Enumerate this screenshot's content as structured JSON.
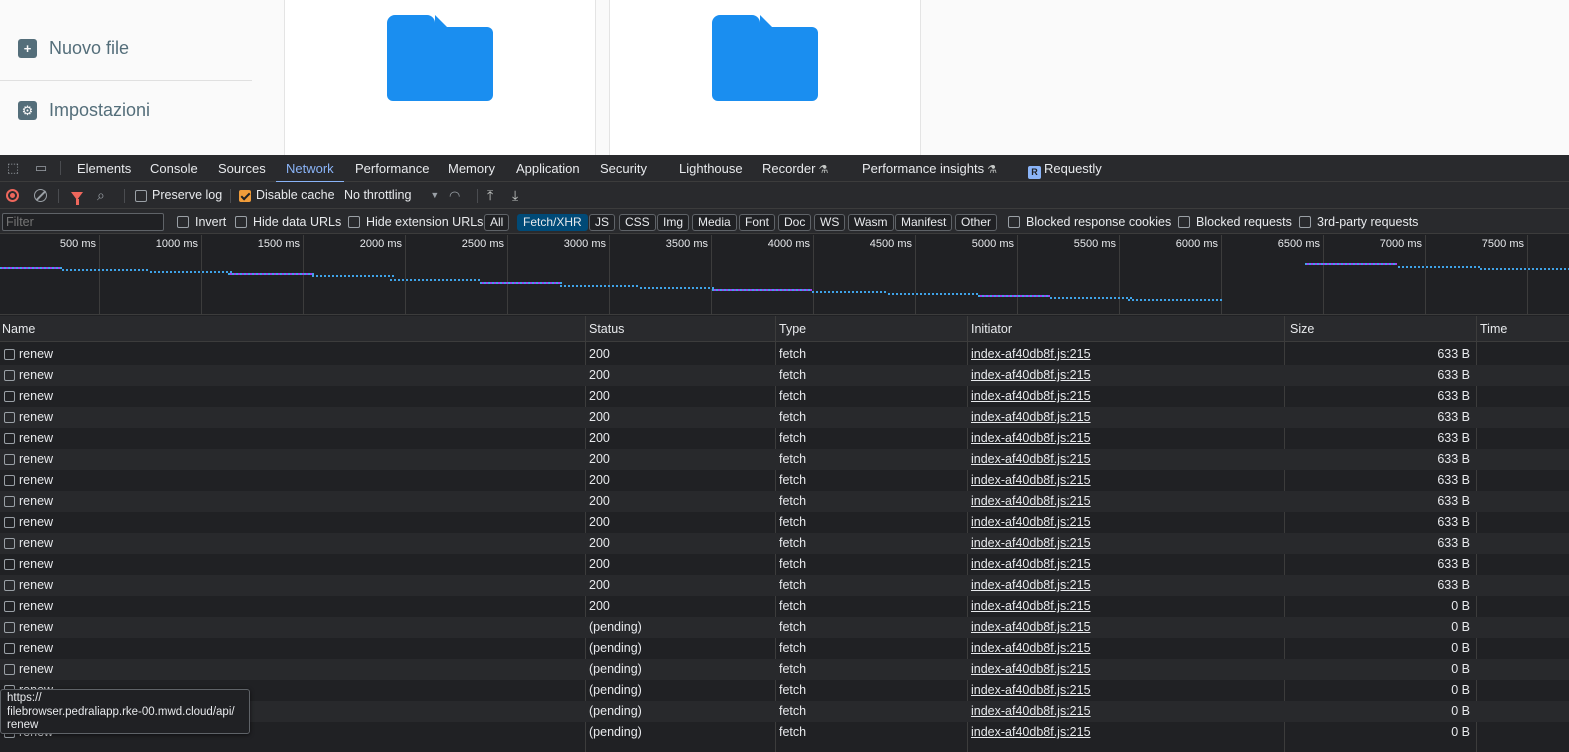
{
  "app": {
    "sidebar": {
      "new_file": "Nuovo file",
      "settings": "Impostazioni"
    }
  },
  "devtools": {
    "tabs": [
      "Elements",
      "Console",
      "Sources",
      "Network",
      "Performance",
      "Memory",
      "Application",
      "Security",
      "Lighthouse",
      "Recorder",
      "Performance insights",
      "Requestly"
    ],
    "active_tab": "Network",
    "toolbar": {
      "preserve_log": "Preserve log",
      "disable_cache": "Disable cache",
      "throttling": "No throttling"
    },
    "filterbar": {
      "filter_placeholder": "Filter",
      "invert": "Invert",
      "hide_data_urls": "Hide data URLs",
      "hide_extension_urls": "Hide extension URLs",
      "types": [
        "All",
        "Fetch/XHR",
        "JS",
        "CSS",
        "Img",
        "Media",
        "Font",
        "Doc",
        "WS",
        "Wasm",
        "Manifest",
        "Other"
      ],
      "active_type": "Fetch/XHR",
      "blocked_response_cookies": "Blocked response cookies",
      "blocked_requests": "Blocked requests",
      "third_party": "3rd-party requests"
    },
    "overview_ticks": [
      "500 ms",
      "1000 ms",
      "1500 ms",
      "2000 ms",
      "2500 ms",
      "3000 ms",
      "3500 ms",
      "4000 ms",
      "4500 ms",
      "5000 ms",
      "5500 ms",
      "6000 ms",
      "6500 ms",
      "7000 ms",
      "7500 ms"
    ],
    "columns": [
      "Name",
      "Status",
      "Type",
      "Initiator",
      "Size",
      "Time"
    ],
    "rows": [
      {
        "name": "renew",
        "status": "200",
        "type": "fetch",
        "initiator": "index-af40db8f.js:215",
        "size": "633 B"
      },
      {
        "name": "renew",
        "status": "200",
        "type": "fetch",
        "initiator": "index-af40db8f.js:215",
        "size": "633 B"
      },
      {
        "name": "renew",
        "status": "200",
        "type": "fetch",
        "initiator": "index-af40db8f.js:215",
        "size": "633 B"
      },
      {
        "name": "renew",
        "status": "200",
        "type": "fetch",
        "initiator": "index-af40db8f.js:215",
        "size": "633 B"
      },
      {
        "name": "renew",
        "status": "200",
        "type": "fetch",
        "initiator": "index-af40db8f.js:215",
        "size": "633 B"
      },
      {
        "name": "renew",
        "status": "200",
        "type": "fetch",
        "initiator": "index-af40db8f.js:215",
        "size": "633 B"
      },
      {
        "name": "renew",
        "status": "200",
        "type": "fetch",
        "initiator": "index-af40db8f.js:215",
        "size": "633 B"
      },
      {
        "name": "renew",
        "status": "200",
        "type": "fetch",
        "initiator": "index-af40db8f.js:215",
        "size": "633 B"
      },
      {
        "name": "renew",
        "status": "200",
        "type": "fetch",
        "initiator": "index-af40db8f.js:215",
        "size": "633 B"
      },
      {
        "name": "renew",
        "status": "200",
        "type": "fetch",
        "initiator": "index-af40db8f.js:215",
        "size": "633 B"
      },
      {
        "name": "renew",
        "status": "200",
        "type": "fetch",
        "initiator": "index-af40db8f.js:215",
        "size": "633 B"
      },
      {
        "name": "renew",
        "status": "200",
        "type": "fetch",
        "initiator": "index-af40db8f.js:215",
        "size": "633 B"
      },
      {
        "name": "renew",
        "status": "200",
        "type": "fetch",
        "initiator": "index-af40db8f.js:215",
        "size": "0 B"
      },
      {
        "name": "renew",
        "status": "(pending)",
        "type": "fetch",
        "initiator": "index-af40db8f.js:215",
        "size": "0 B"
      },
      {
        "name": "renew",
        "status": "(pending)",
        "type": "fetch",
        "initiator": "index-af40db8f.js:215",
        "size": "0 B"
      },
      {
        "name": "renew",
        "status": "(pending)",
        "type": "fetch",
        "initiator": "index-af40db8f.js:215",
        "size": "0 B"
      },
      {
        "name": "renew",
        "status": "(pending)",
        "type": "fetch",
        "initiator": "index-af40db8f.js:215",
        "size": "0 B"
      },
      {
        "name": "renew",
        "status": "(pending)",
        "type": "fetch",
        "initiator": "index-af40db8f.js:215",
        "size": "0 B"
      },
      {
        "name": "renew",
        "status": "(pending)",
        "type": "fetch",
        "initiator": "index-af40db8f.js:215",
        "size": "0 B"
      }
    ],
    "tooltip": "https://\nfilebrowser.pedraliapp.rke-00.mwd.cloud/api/\nrenew"
  }
}
